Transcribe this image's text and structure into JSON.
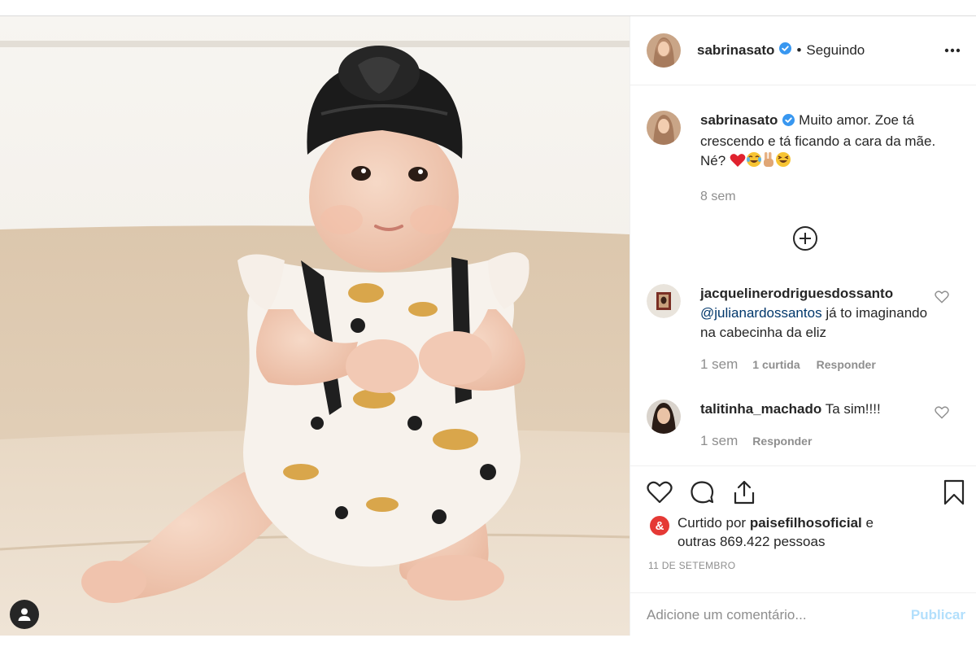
{
  "post": {
    "author": {
      "username": "sabrinasato",
      "verified": true,
      "separator": "•",
      "follow_status": "Seguindo",
      "avatar_icon": "profile-avatar"
    },
    "caption": {
      "username": "sabrinasato",
      "text": "Muito amor. Zoe tá crescendo e tá ficando a cara da mãe. Né?",
      "emojis": [
        "red-heart",
        "joy-face",
        "victory-hand",
        "laughing-face"
      ],
      "time": "8 sem"
    },
    "comments": [
      {
        "username": "jacquelinerodriguesdossanto",
        "mention": "@julianardossantos",
        "text": "já to imaginando na cabecinha da eliz",
        "time": "1 sem",
        "likes": "1 curtida",
        "reply": "Responder"
      },
      {
        "username": "talitinha_machado",
        "mention": "",
        "text": "Ta sim!!!!",
        "time": "1 sem",
        "likes": "",
        "reply": "Responder"
      }
    ],
    "likes": {
      "prefix": "Curtido por",
      "liker": "paisefilhosoficial",
      "connector": "e",
      "others": "outras 869.422 pessoas",
      "liker_logo_text": "&"
    },
    "date": "11 DE SETEMBRO",
    "add_comment": {
      "placeholder": "Adicione um comentário...",
      "publish_label": "Publicar"
    }
  },
  "colors": {
    "text": "#262626",
    "secondary": "#8e8e8e",
    "link": "#00376b",
    "publish_disabled": "#b2dffc",
    "verified": "#3897f0",
    "border": "#efefef"
  }
}
